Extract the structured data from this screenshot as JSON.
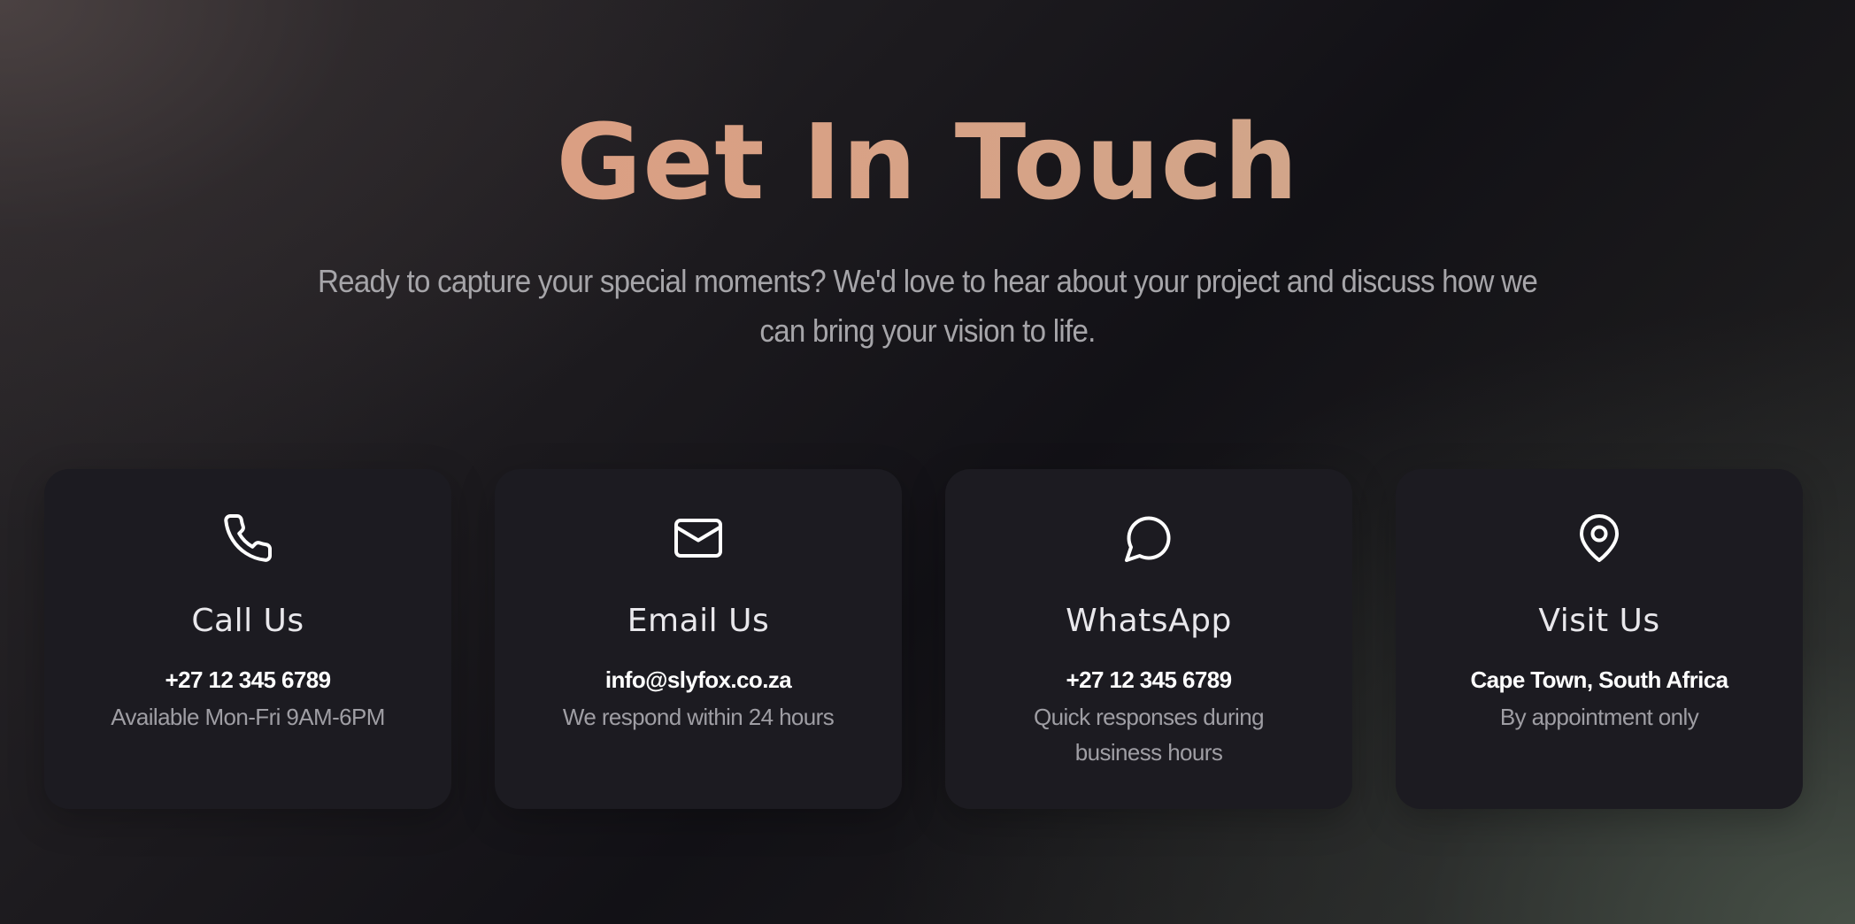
{
  "header": {
    "title": "Get In Touch",
    "subtitle": "Ready to capture your special moments? We'd love to hear about your project and discuss how we can bring your vision to life."
  },
  "cards": [
    {
      "icon": "phone-icon",
      "title": "Call Us",
      "value": "+27 12 345 6789",
      "note": "Available Mon-Fri 9AM-6PM"
    },
    {
      "icon": "mail-icon",
      "title": "Email Us",
      "value": "info@slyfox.co.za",
      "note": "We respond within 24 hours"
    },
    {
      "icon": "chat-bubble-icon",
      "title": "WhatsApp",
      "value": "+27 12 345 6789",
      "note": "Quick responses during business hours"
    },
    {
      "icon": "map-pin-icon",
      "title": "Visit Us",
      "value": "Cape Town, South Africa",
      "note": "By appointment only"
    }
  ],
  "colors": {
    "title_gradient_start": "#df9a7e",
    "title_gradient_end": "#c9aa8f",
    "card_background": "#1c1b21",
    "subtitle_text": "#a6a5a9",
    "note_text": "#9f9ea4"
  }
}
